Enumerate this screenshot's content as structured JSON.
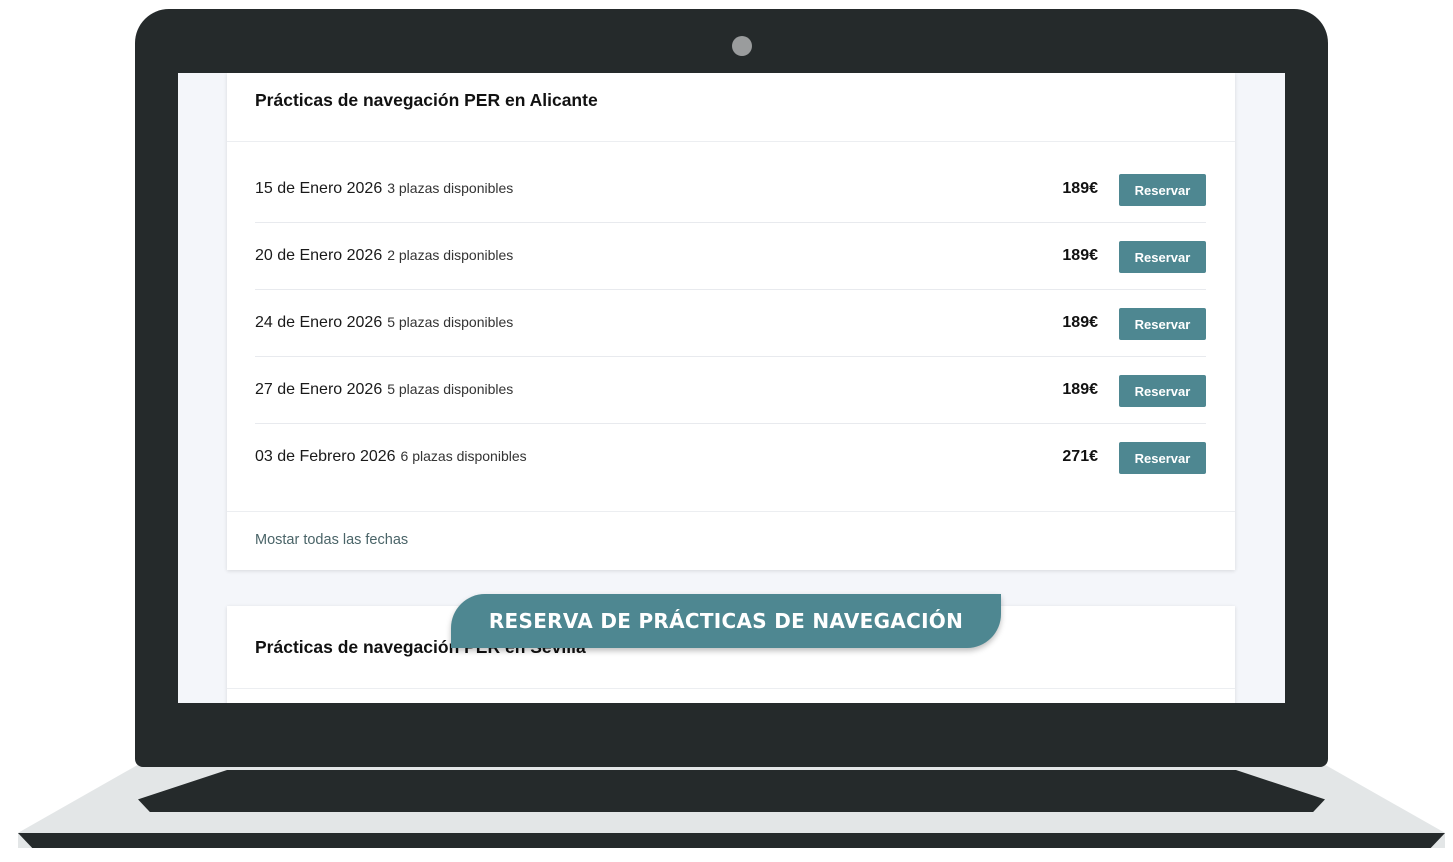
{
  "cards": [
    {
      "title": "Prácticas de navegación PER en Alicante",
      "rows": [
        {
          "date": "15 de Enero 2026",
          "spots": "3 plazas disponibles",
          "price": "189€",
          "button": "Reservar"
        },
        {
          "date": "20 de Enero 2026",
          "spots": "2 plazas disponibles",
          "price": "189€",
          "button": "Reservar"
        },
        {
          "date": "24 de Enero 2026",
          "spots": "5 plazas disponibles",
          "price": "189€",
          "button": "Reservar"
        },
        {
          "date": "27 de Enero 2026",
          "spots": "5 plazas disponibles",
          "price": "189€",
          "button": "Reservar"
        },
        {
          "date": "03 de Febrero 2026",
          "spots": "6 plazas disponibles",
          "price": "271€",
          "button": "Reservar"
        }
      ],
      "footer_link": "Mostar todas las fechas"
    },
    {
      "title": "Prácticas de navegación PER en Sevilla"
    }
  ],
  "banner": {
    "text": "RESERVA DE PRÁCTICAS DE NAVEGACIÓN"
  },
  "colors": {
    "accent": "#4e8791",
    "bezel": "#252a2b",
    "screen_bg": "#f4f6fa"
  }
}
